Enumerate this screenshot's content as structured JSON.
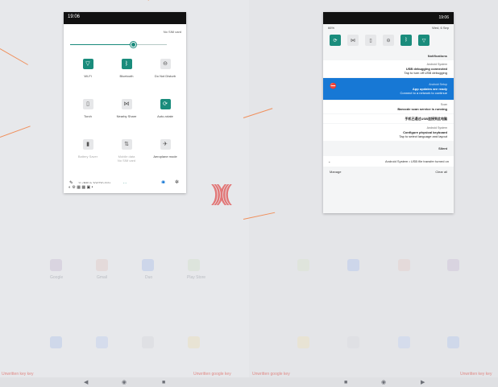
{
  "quick_settings": {
    "time": "19:06",
    "sim": "No SIM card",
    "tiles": [
      {
        "label": "Wi-Fi",
        "icon": "wifi-icon",
        "glyph": "▽",
        "on": true
      },
      {
        "label": "Bluetooth",
        "icon": "bluetooth-icon",
        "glyph": "ᛒ",
        "on": true
      },
      {
        "label": "Do Not Disturb",
        "icon": "dnd-icon",
        "glyph": "⊖",
        "on": false
      },
      {
        "label": "Torch",
        "icon": "torch-icon",
        "glyph": "▯",
        "on": false
      },
      {
        "label": "Nearby Share",
        "icon": "nearby-share-icon",
        "glyph": "⋈",
        "on": false
      },
      {
        "label": "Auto-rotate",
        "icon": "rotate-icon",
        "glyph": "⟳",
        "on": true
      },
      {
        "label": "Battery Saver",
        "icon": "battery-icon",
        "glyph": "▮",
        "on": false,
        "dim": true
      },
      {
        "label": "Mobile data\nNo SIM card",
        "icon": "mobile-data-icon",
        "glyph": "⇅",
        "on": false,
        "dim": true
      },
      {
        "label": "Aeroplane mode",
        "icon": "airplane-icon",
        "glyph": "✈",
        "on": false
      }
    ],
    "build": "11 (RP1A.200720.011)",
    "brightness": 0.66
  },
  "notification_shade": {
    "time": "19:06",
    "date": "Wed, 6 Sep",
    "battery": "66%",
    "notifications_header": "Notifications",
    "notifications": [
      {
        "app": "Android System",
        "title": "USB debugging connected",
        "text": "Tap to turn off USB debugging"
      },
      {
        "app": "Android Setup",
        "title": "App updates are ready",
        "text": "Connect to a network to continue",
        "highlight": true
      },
      {
        "app": "Scan",
        "title": "Barcode scan service is running",
        "text": ""
      },
      {
        "app": "",
        "title": "手机已通过USB连接到此电脑",
        "text": ""
      },
      {
        "app": "Android System",
        "title": "Configure physical keyboard",
        "text": "Tap to select language and layout"
      }
    ],
    "silent_header": "Silent",
    "silent_item": "Android System • USB file transfer turned on",
    "manage": "Manage",
    "clear_all": "Clear all"
  },
  "launcher": {
    "apps": [
      "Google",
      "Gmail",
      "Duo",
      "Play Store"
    ],
    "hint_left": "Unwritten key key",
    "hint_right": "Unwritten google key",
    "hint_right_b": "Unwritten key key",
    "hint_left_b": "Unwritten google key"
  },
  "colors": {
    "accent": "#1a8c7c",
    "highlight": "#1778d5"
  }
}
